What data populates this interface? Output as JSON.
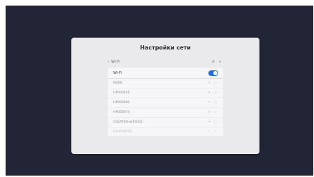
{
  "dialog": {
    "title": "Настройки сети",
    "back_label": "Wi-Fi",
    "header_icons": "⇵ +"
  },
  "wifi": {
    "label": "Wi-Fi",
    "toggle_on": true
  },
  "networks": [
    {
      "ssid": "MSHK",
      "icons": "• ◌"
    },
    {
      "ssid": "HP000026",
      "icons": "• ◌"
    },
    {
      "ssid": "HP000080",
      "icons": "• ◌"
    },
    {
      "ssid": "HP000074",
      "icons": "• ◌"
    },
    {
      "ssid": "CREATED-wifi4002",
      "icons": "• ◌"
    },
    {
      "ssid": "HP-PRINTER",
      "icons": "• ◌"
    }
  ],
  "colors": {
    "accent": "#1f6fe8",
    "background": "#222536",
    "panel": "#eaeaec"
  }
}
